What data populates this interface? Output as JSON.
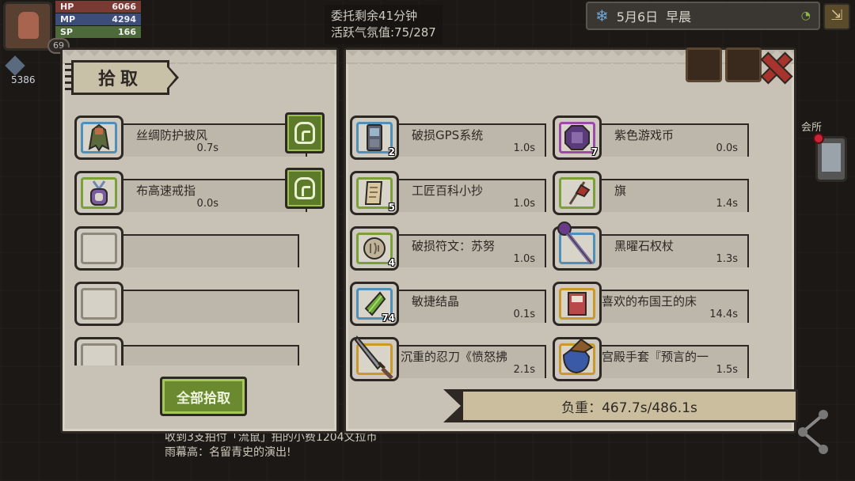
{
  "hud": {
    "hp_label": "HP",
    "hp_value": "6066",
    "mp_label": "MP",
    "mp_value": "4294",
    "sp_label": "SP",
    "sp_value": "166",
    "level": "69",
    "gems": "5386"
  },
  "quest": {
    "line1": "委托剩余41分钟",
    "line2": "活跃气氛值:75/287"
  },
  "datebar": {
    "date": "5月6日",
    "time_of_day": "早晨"
  },
  "side": {
    "guild_label": "会所"
  },
  "pickup_panel": {
    "title": "拾取",
    "items": [
      {
        "name": "丝绸防护披风",
        "time": "0.7s",
        "frame": "blue",
        "sprite": "cloak-icon"
      },
      {
        "name": "布高速戒指",
        "time": "0.0s",
        "frame": "green",
        "sprite": "ring-icon"
      },
      {
        "name": "",
        "time": "",
        "frame": "empty"
      },
      {
        "name": "",
        "time": "",
        "frame": "empty"
      },
      {
        "name": "",
        "time": "",
        "frame": "empty"
      }
    ],
    "pick_all_label": "全部拾取"
  },
  "loot_panel": {
    "items": [
      {
        "name": "破损GPS系统",
        "time": "1.0s",
        "count": "2",
        "frame": "blue",
        "sprite": "gps-icon"
      },
      {
        "name": "紫色游戏币",
        "time": "0.0s",
        "count": "7",
        "frame": "purple",
        "sprite": "coin-icon"
      },
      {
        "name": "工匠百科小抄",
        "time": "1.0s",
        "count": "5",
        "frame": "green",
        "sprite": "scroll-icon"
      },
      {
        "name": "旗",
        "time": "1.4s",
        "count": "",
        "frame": "green",
        "sprite": "flag-icon"
      },
      {
        "name": "破损符文：苏努",
        "time": "1.0s",
        "count": "4",
        "frame": "green",
        "sprite": "rune-icon"
      },
      {
        "name": "黑曜石权杖",
        "time": "1.3s",
        "count": "",
        "frame": "blue",
        "sprite": "scepter-icon"
      },
      {
        "name": "敏捷结晶",
        "time": "0.1s",
        "count": "74",
        "frame": "blue",
        "sprite": "crystal-icon"
      },
      {
        "name": "喜欢的布国王的床",
        "time": "14.4s",
        "count": "",
        "frame": "gold",
        "sprite": "bed-icon"
      },
      {
        "name": "沉重的忍刀《愤怒拂",
        "time": "2.1s",
        "count": "",
        "frame": "gold",
        "sprite": "sword-icon"
      },
      {
        "name": "宫殿手套『预言的一",
        "time": "1.5s",
        "count": "",
        "frame": "gold",
        "sprite": "glove-icon"
      }
    ],
    "weight_label": "负重：467.7s/486.1s"
  },
  "chat": {
    "line1": "收到3支拍付「流鼠」拍的小费1204文拉币",
    "line2": "雨幕高：名留青史的演出!"
  },
  "colors": {
    "panel": "#c8c2b6",
    "frame_blue": "#4f8fb8",
    "frame_green": "#7ba03a",
    "frame_purple": "#9a4aa8",
    "frame_gold": "#c99a2a",
    "button_green": "#6b8a30",
    "close_red": "#a8322c"
  }
}
